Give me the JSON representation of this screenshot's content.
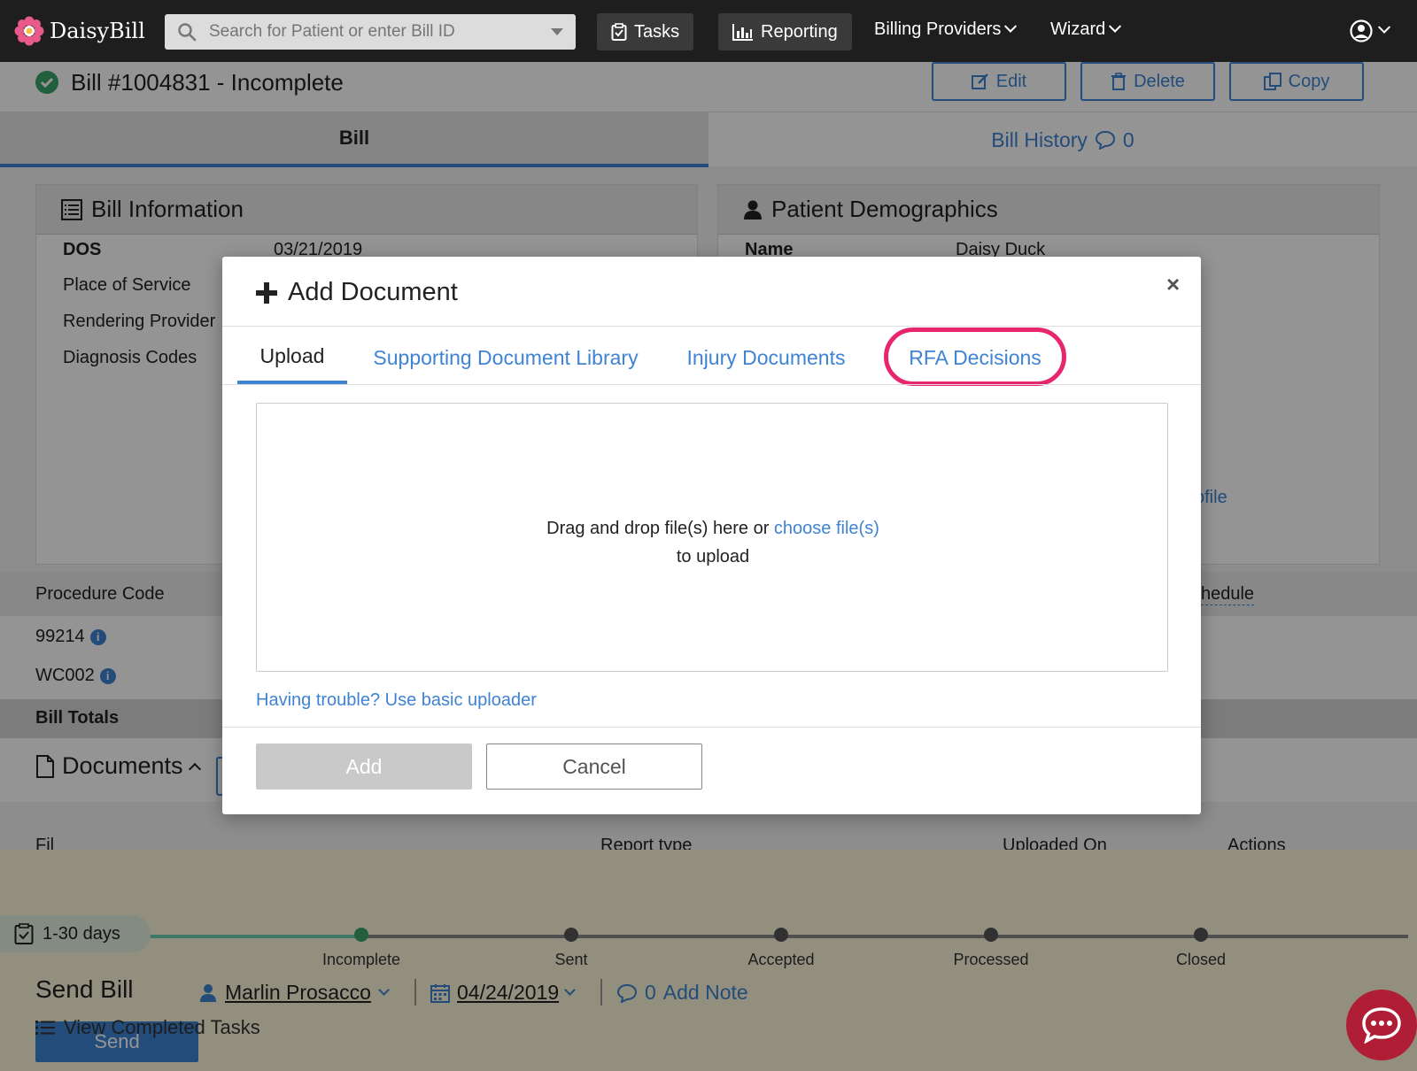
{
  "nav": {
    "logo_text": "DaisyBill",
    "search_placeholder": "Search for Patient or enter Bill ID",
    "tasks_label": "Tasks",
    "reporting_label": "Reporting",
    "billing_providers_label": "Billing Providers",
    "wizard_label": "Wizard"
  },
  "bill": {
    "title": "Bill #1004831 - Incomplete",
    "edit_label": "Edit",
    "delete_label": "Delete",
    "copy_label": "Copy",
    "tab_bill": "Bill",
    "tab_history": "Bill History",
    "history_count": "0"
  },
  "bill_info": {
    "heading": "Bill Information",
    "rows": [
      {
        "label": "DOS",
        "value": "03/21/2019"
      },
      {
        "label": "Place of Service",
        "value": ""
      },
      {
        "label": "Rendering Provider",
        "value": ""
      },
      {
        "label": "Diagnosis Codes",
        "value": ""
      }
    ]
  },
  "patient": {
    "heading": "Patient Demographics",
    "name_label": "Name",
    "name_value": "Daisy Duck",
    "profile_fragment": "ofile"
  },
  "procedures": {
    "header": "Procedure Code",
    "schedule_fragment": "hedule",
    "codes": [
      "99214",
      "WC002"
    ],
    "totals_label": "Bill Totals"
  },
  "documents": {
    "heading": "Documents",
    "col_fragment": "Fil",
    "col_report_type": "Report type",
    "col_uploaded_on": "Uploaded On",
    "col_actions": "Actions"
  },
  "workflow": {
    "days_label": "1-30 days",
    "stages": [
      "Incomplete",
      "Sent",
      "Accepted",
      "Processed",
      "Closed"
    ],
    "send_label": "Send Bill",
    "assignee": "Marlin Prosacco",
    "date": "04/24/2019",
    "note_count": "0",
    "add_note_label": "Add Note",
    "send_button": "Send",
    "view_completed": "View Completed Tasks"
  },
  "modal": {
    "title": "Add Document",
    "close_glyph": "×",
    "tabs": [
      "Upload",
      "Supporting Document Library",
      "Injury Documents",
      "RFA Decisions"
    ],
    "active_tab": "Upload",
    "drop_text": "Drag and drop file(s) here or",
    "choose_link": "choose file(s)",
    "drop_text_2": "to upload",
    "trouble_link": "Having trouble? Use basic uploader",
    "add_button": "Add",
    "cancel_button": "Cancel"
  },
  "colors": {
    "accent": "#3f83d2",
    "highlight_ring": "#e8266e",
    "success": "#3ca46a",
    "nav_bg": "#1e1e1e"
  }
}
